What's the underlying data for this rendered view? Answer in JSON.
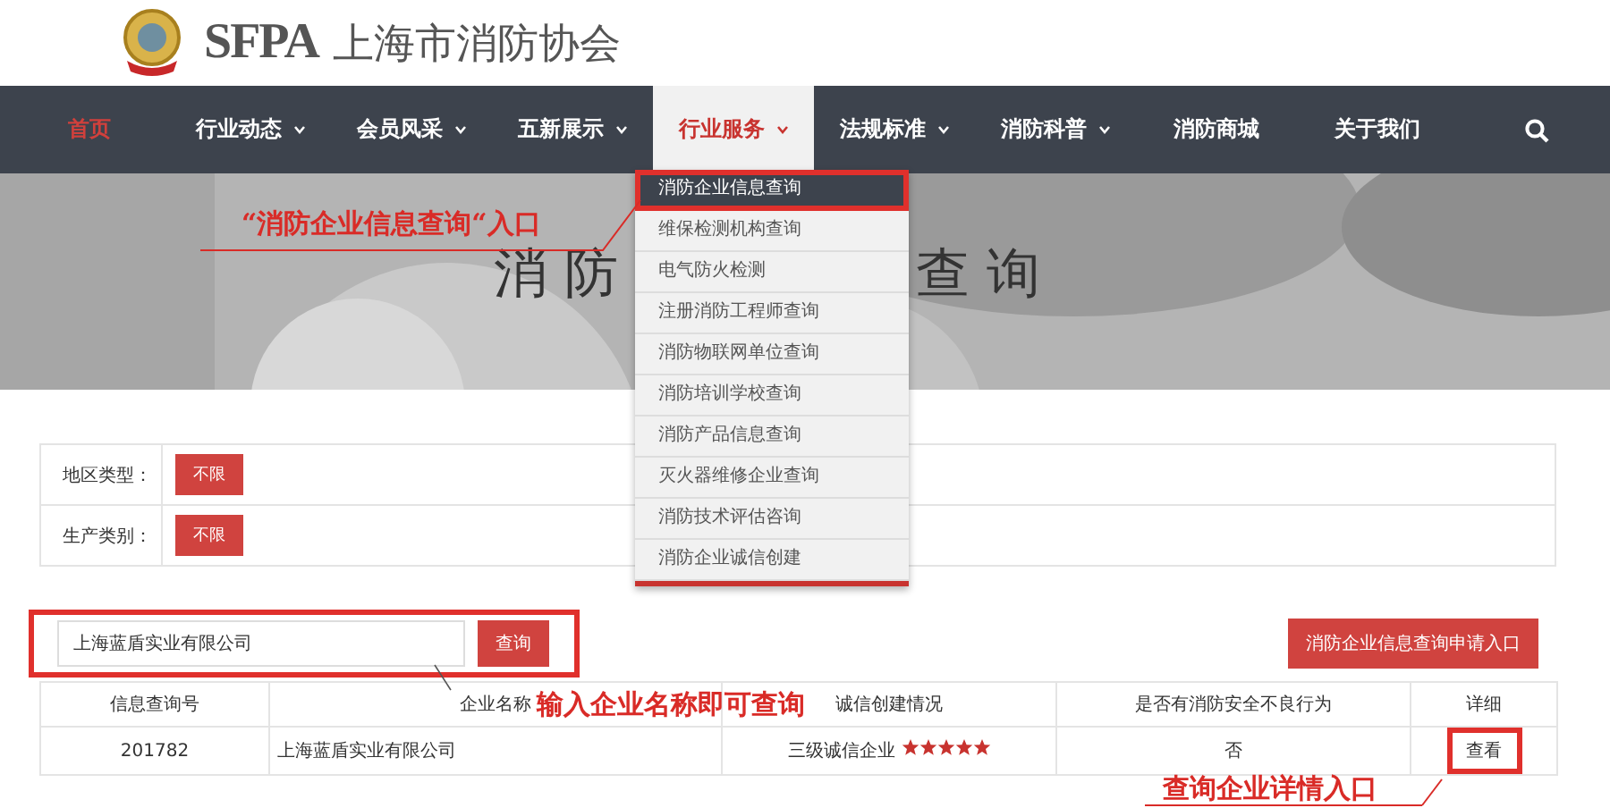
{
  "header": {
    "logo_text": "SFPA",
    "site_name": "上海市消防协会"
  },
  "nav": {
    "items": [
      {
        "label": "首页",
        "has_menu": false,
        "current": true,
        "selected": false
      },
      {
        "label": "行业动态",
        "has_menu": true,
        "current": false,
        "selected": false
      },
      {
        "label": "会员风采",
        "has_menu": true,
        "current": false,
        "selected": false
      },
      {
        "label": "五新展示",
        "has_menu": true,
        "current": false,
        "selected": false
      },
      {
        "label": "行业服务",
        "has_menu": true,
        "current": false,
        "selected": true
      },
      {
        "label": "法规标准",
        "has_menu": true,
        "current": false,
        "selected": false
      },
      {
        "label": "消防科普",
        "has_menu": true,
        "current": false,
        "selected": false
      },
      {
        "label": "消防商城",
        "has_menu": false,
        "current": false,
        "selected": false
      },
      {
        "label": "关于我们",
        "has_menu": false,
        "current": false,
        "selected": false
      }
    ]
  },
  "banner": {
    "title_left": "消 防",
    "title_right": "查 询"
  },
  "dropdown": {
    "items": [
      {
        "label": "消防企业信息查询",
        "selected": true
      },
      {
        "label": "维保检测机构查询",
        "selected": false
      },
      {
        "label": "电气防火检测",
        "selected": false
      },
      {
        "label": "注册消防工程师查询",
        "selected": false
      },
      {
        "label": "消防物联网单位查询",
        "selected": false
      },
      {
        "label": "消防培训学校查询",
        "selected": false
      },
      {
        "label": "消防产品信息查询",
        "selected": false
      },
      {
        "label": "灭火器维修企业查询",
        "selected": false
      },
      {
        "label": "消防技术评估咨询",
        "selected": false
      },
      {
        "label": "消防企业诚信创建",
        "selected": false
      }
    ]
  },
  "filters": [
    {
      "label": "地区类型：",
      "value": "不限"
    },
    {
      "label": "生产类别：",
      "value": "不限"
    }
  ],
  "search": {
    "value": "上海蓝盾实业有限公司",
    "button": "查询",
    "apply_button": "消防企业信息查询申请入口"
  },
  "table": {
    "columns": [
      "信息查询号",
      "企业名称",
      "诚信创建情况",
      "是否有消防安全不良行为",
      "详细"
    ],
    "rows": [
      {
        "id": "201782",
        "name": "上海蓝盾实业有限公司",
        "credit": "三级诚信企业",
        "stars": 5,
        "bad_record": "否",
        "action": "查看"
      }
    ]
  },
  "annotations": [
    {
      "text": "“消防企业信息查询“入口"
    },
    {
      "text": "输入企业名称即可查询"
    },
    {
      "text": "查询企业详情入口"
    }
  ]
}
